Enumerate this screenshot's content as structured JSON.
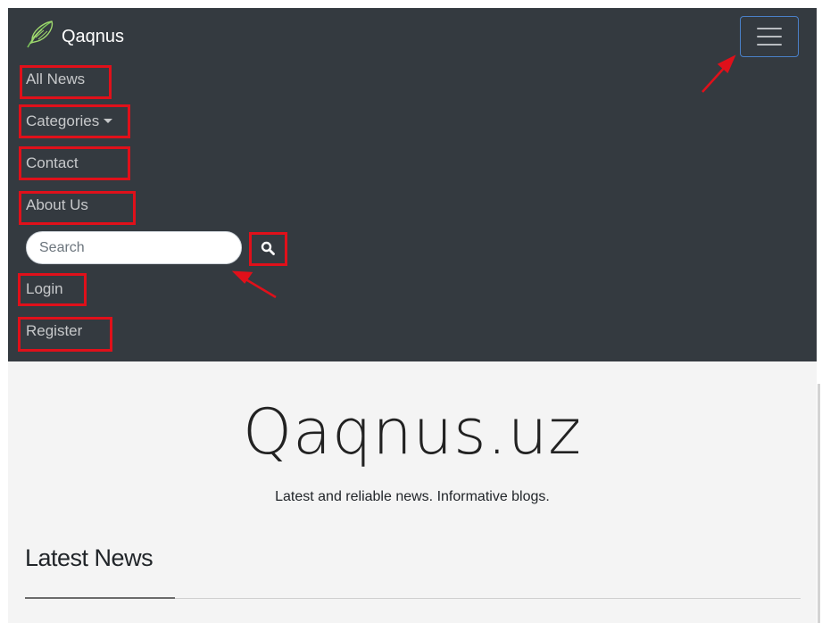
{
  "brand": {
    "name": "Qaqnus",
    "logo_icon": "feather-icon"
  },
  "navbar": {
    "items": [
      {
        "label": "All News"
      },
      {
        "label": "Categories"
      },
      {
        "label": "Contact"
      },
      {
        "label": "About Us"
      }
    ],
    "search": {
      "placeholder": "Search",
      "value": ""
    },
    "auth": [
      {
        "label": "Login"
      },
      {
        "label": "Register"
      }
    ],
    "toggler_icon": "hamburger-icon"
  },
  "hero": {
    "title": "Qaqnus.uz",
    "subtitle": "Latest and reliable news. Informative blogs."
  },
  "section": {
    "heading": "Latest News"
  },
  "annotation_color": "#e0101a",
  "navbar_color": "#343a40",
  "accent_border": "#4a80c8"
}
